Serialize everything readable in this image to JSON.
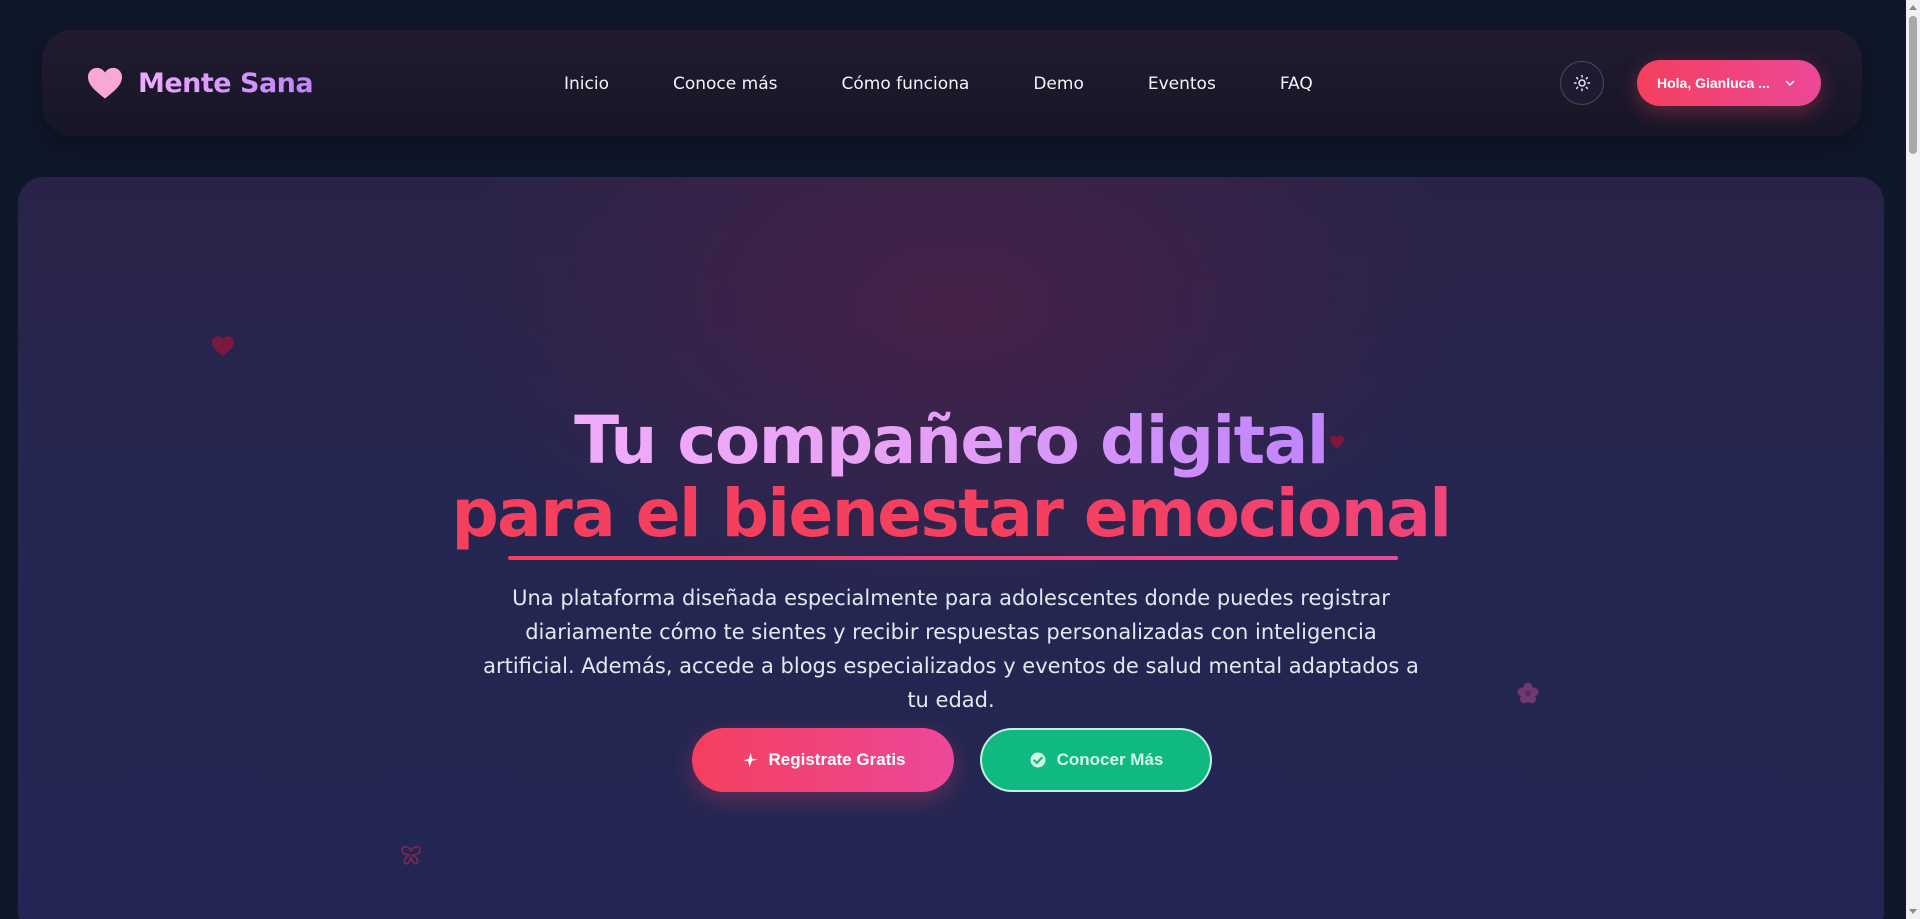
{
  "header": {
    "brand_name": "Mente Sana",
    "brand_icon": "heart-icon",
    "nav": [
      {
        "label": "Inicio"
      },
      {
        "label": "Conoce más"
      },
      {
        "label": "Cómo funciona"
      },
      {
        "label": "Demo"
      },
      {
        "label": "Eventos"
      },
      {
        "label": "FAQ"
      }
    ],
    "theme_toggle_icon": "sun-icon",
    "user_menu_label": "Hola, Gianluca ...",
    "user_menu_icon": "chevron-down-icon"
  },
  "hero": {
    "title_line_1": "Tu compañero digital",
    "title_line_2": "para el bienestar emocional",
    "subtitle": "Una plataforma diseñada especialmente para adolescentes donde puedes registrar diariamente cómo te sientes y recibir respuestas personalizadas con inteligencia artificial. Además, accede a blogs especializados y eventos de salud mental adaptados a tu edad.",
    "primary_cta": "Registrate Gratis",
    "primary_cta_icon": "sparkle-icon",
    "secondary_cta": "Conocer Más",
    "secondary_cta_icon": "check-circle-icon"
  },
  "colors": {
    "background": "#0f172a",
    "accent_pink": "#f43f5e",
    "accent_magenta": "#ec4899",
    "accent_purple": "#c084fc",
    "accent_green": "#10b981"
  }
}
